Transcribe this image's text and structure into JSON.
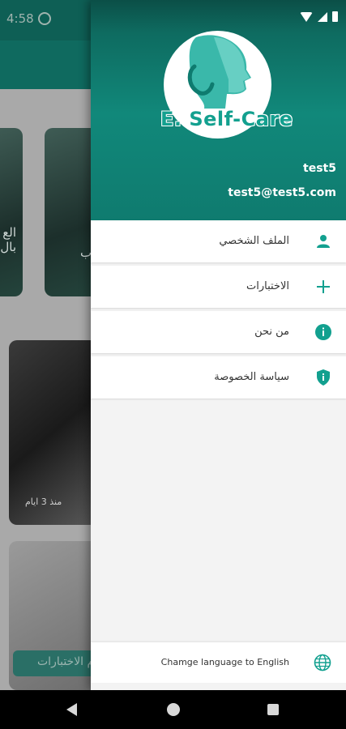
{
  "status_bar": {
    "time": "4:58"
  },
  "background": {
    "card_left_text": "الع بال",
    "card_right_text": "ب",
    "photo_caption": "منذ 3 ايام",
    "button_label": "م الاختبارات"
  },
  "drawer": {
    "logo_text": "E. Self-Care",
    "user_name": "test5",
    "user_email": "test5@test5.com",
    "menu": [
      {
        "label": "الملف الشخصي",
        "icon": "person-icon"
      },
      {
        "label": "الاختبارات",
        "icon": "plus-icon"
      },
      {
        "label": "من نحن",
        "icon": "info-icon"
      },
      {
        "label": "سياسة الخصوصة",
        "icon": "shield-icon"
      }
    ],
    "language": {
      "label": "Chamge language to English",
      "icon": "globe-icon"
    }
  },
  "colors": {
    "accent": "#12a08f",
    "header": "#0f7b6f"
  }
}
